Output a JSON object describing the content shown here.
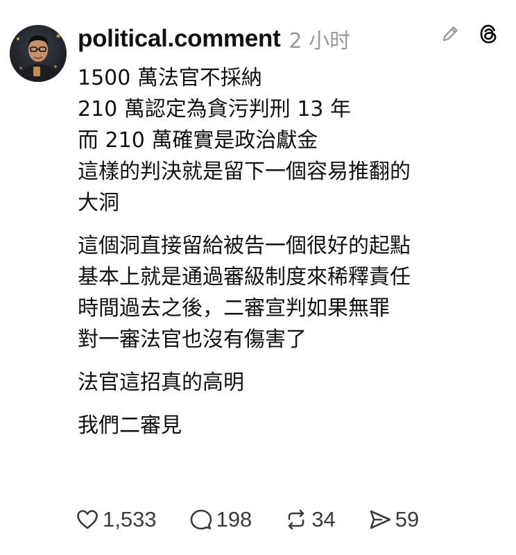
{
  "post": {
    "username": "political.comment",
    "timestamp": "2 小时",
    "paragraphs": [
      [
        "1500 萬法官不採納",
        "210 萬認定為貪污判刑 13 年",
        "而 210 萬確實是政治獻金",
        "這樣的判決就是留下一個容易推翻的",
        "大洞"
      ],
      [
        "這個洞直接留給被告一個很好的起點",
        "基本上就是通過審級制度來稀釋責任",
        "時間過去之後，二審宣判如果無罪",
        "對一審法官也沒有傷害了"
      ],
      [
        "法官這招真的高明"
      ],
      [
        "我們二審見"
      ]
    ]
  },
  "top_icons": [
    "edit-pencil-icon",
    "threads-logo-icon"
  ],
  "actions": {
    "likes": "1,533",
    "comments": "198",
    "reposts": "34",
    "shares": "59"
  },
  "colors": {
    "text": "#111111",
    "muted": "#9a9a9a",
    "icon": "#3a3a3a"
  }
}
